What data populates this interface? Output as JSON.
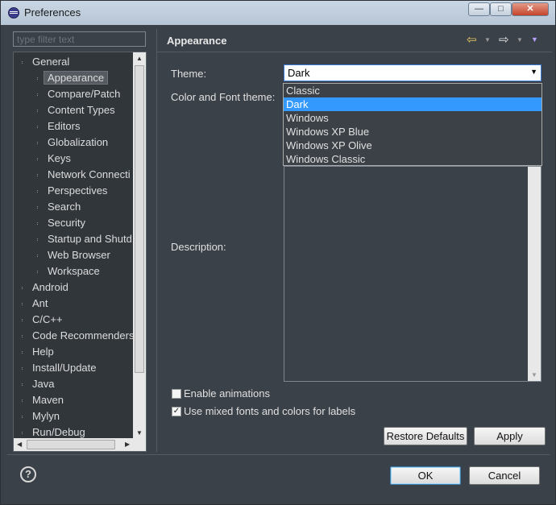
{
  "window": {
    "title": "Preferences",
    "buttons": [
      "—",
      "□",
      "✕"
    ]
  },
  "filter": {
    "placeholder": "type filter text"
  },
  "tree": {
    "items": [
      {
        "label": "General",
        "level": 0,
        "expanded": true
      },
      {
        "label": "Appearance",
        "level": 1,
        "selected": true
      },
      {
        "label": "Compare/Patch",
        "level": 1
      },
      {
        "label": "Content Types",
        "level": 1
      },
      {
        "label": "Editors",
        "level": 1
      },
      {
        "label": "Globalization",
        "level": 1
      },
      {
        "label": "Keys",
        "level": 1
      },
      {
        "label": "Network Connecti",
        "level": 1
      },
      {
        "label": "Perspectives",
        "level": 1
      },
      {
        "label": "Search",
        "level": 1
      },
      {
        "label": "Security",
        "level": 1
      },
      {
        "label": "Startup and Shutd",
        "level": 1
      },
      {
        "label": "Web Browser",
        "level": 1
      },
      {
        "label": "Workspace",
        "level": 1
      },
      {
        "label": "Android",
        "level": 0
      },
      {
        "label": "Ant",
        "level": 0
      },
      {
        "label": "C/C++",
        "level": 0
      },
      {
        "label": "Code Recommenders",
        "level": 0
      },
      {
        "label": "Help",
        "level": 0
      },
      {
        "label": "Install/Update",
        "level": 0
      },
      {
        "label": "Java",
        "level": 0
      },
      {
        "label": "Maven",
        "level": 0
      },
      {
        "label": "Mylyn",
        "level": 0
      },
      {
        "label": "Run/Debug",
        "level": 0
      }
    ]
  },
  "page": {
    "title": "Appearance",
    "theme_label": "Theme:",
    "theme_value": "Dark",
    "color_font_label": "Color and Font theme:",
    "theme_options": [
      "Classic",
      "Dark",
      "Windows",
      "Windows XP Blue",
      "Windows XP Olive",
      "Windows Classic"
    ],
    "theme_selected_index": 1,
    "description_label": "Description:",
    "enable_animations": {
      "label": "Enable animations",
      "checked": false
    },
    "mixed_fonts": {
      "label": "Use mixed fonts and colors for labels",
      "checked": true
    },
    "restore_defaults": "Restore Defaults",
    "apply": "Apply"
  },
  "footer": {
    "ok": "OK",
    "cancel": "Cancel",
    "help": "?"
  },
  "colors": {
    "background": "#3b4148",
    "selection": "#3399ff",
    "text": "#e0e0e0"
  }
}
